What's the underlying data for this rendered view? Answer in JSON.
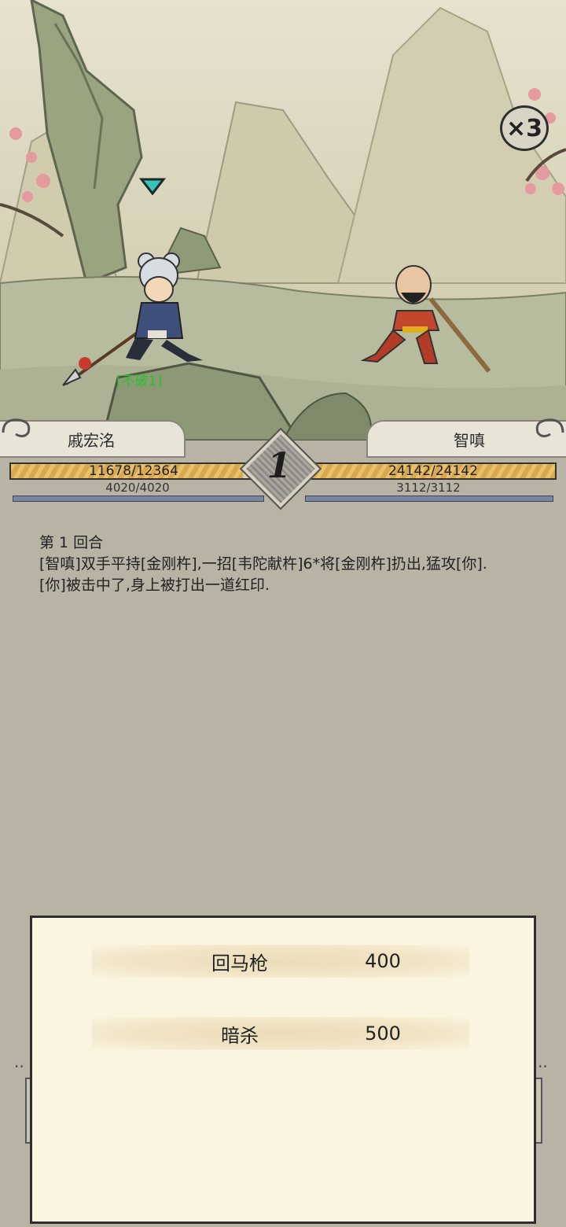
{
  "battle": {
    "speed_multiplier": "×3",
    "round_number": "1",
    "buff_tag": "[不破1]"
  },
  "player": {
    "name": "戚宏洺",
    "hp_text": "11678/12364",
    "hp_fraction": 0.944,
    "mp_text": "4020/4020"
  },
  "enemy": {
    "name": "智嗔",
    "hp_text": "24142/24142",
    "hp_fraction": 1.0,
    "mp_text": "3112/3112"
  },
  "log": {
    "lines": [
      "第 1 回合",
      "[智嗔]双手平持[金刚杵],一招[韦陀献杵]6*将[金刚杵]扔出,猛攻[你].",
      "[你]被击中了,身上被打出一道红印."
    ]
  },
  "skills": [
    {
      "name": "回马枪",
      "cost": "400"
    },
    {
      "name": "暗杀",
      "cost": "500"
    }
  ],
  "colors": {
    "hp_fill": "#e0b35e",
    "mp_fill": "#7986a8",
    "buff": "#2cc22c",
    "panel_bg": "#fbf4e0"
  }
}
